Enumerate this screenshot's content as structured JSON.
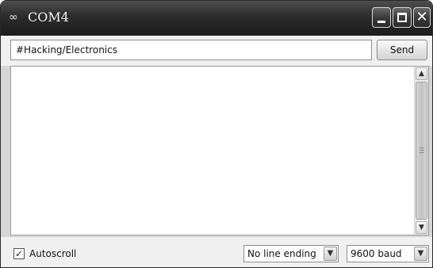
{
  "window": {
    "title": "COM4",
    "title_icon": "infinity-icon",
    "controls": {
      "minimize": "minimize-icon",
      "maximize": "maximize-icon",
      "close": "close-icon"
    }
  },
  "input": {
    "value": "#Hacking/Electronics",
    "send_label": "Send"
  },
  "output": {
    "text": ""
  },
  "footer": {
    "autoscroll_label": "Autoscroll",
    "autoscroll_checked": true,
    "line_ending": "No line ending",
    "baud_rate": "9600 baud"
  },
  "colors": {
    "titlebar": "#2b2b2b",
    "background": "#f0f0f0"
  }
}
